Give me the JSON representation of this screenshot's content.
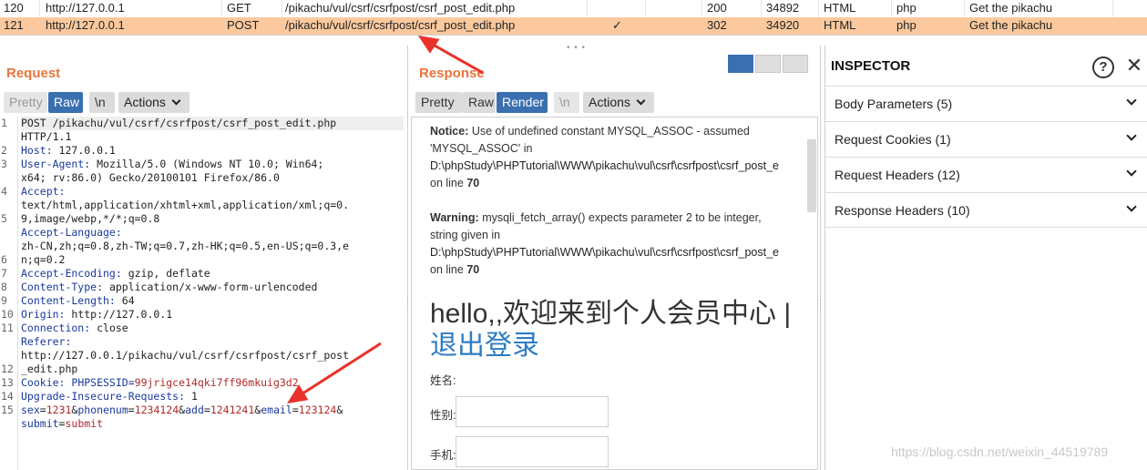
{
  "history": [
    {
      "num": "120",
      "host": "http://127.0.0.1",
      "method": "GET",
      "url": "/pikachu/vul/csrf/csrfpost/csrf_post_edit.php",
      "edited": "",
      "status": "200",
      "length": "34892",
      "mime": "HTML",
      "ext": "php",
      "title": "Get the pikachu"
    },
    {
      "num": "121",
      "host": "http://127.0.0.1",
      "method": "POST",
      "url": "/pikachu/vul/csrf/csrfpost/csrf_post_edit.php",
      "edited": "✓",
      "status": "302",
      "length": "34920",
      "mime": "HTML",
      "ext": "php",
      "title": "Get the pikachu"
    }
  ],
  "grip": "• • •",
  "request": {
    "title": "Request",
    "buttons": {
      "pretty": "Pretty",
      "raw": "Raw",
      "newline": "\\n",
      "actions": "Actions"
    },
    "line_numbers": [
      "1",
      "",
      "2",
      "3",
      "",
      "4",
      "",
      "5",
      "",
      "",
      "6",
      "7",
      "8",
      "9",
      "10",
      "11",
      "",
      "",
      "12",
      "13",
      "14",
      "15",
      ""
    ],
    "lines": [
      {
        "k": "POST /pikachu/vul/csrf/csrfpost/csrf_post_edit.php",
        "v": ""
      },
      {
        "k": "HTTP/1.1",
        "v": ""
      },
      {
        "k": "Host:",
        "v": " 127.0.0.1"
      },
      {
        "k": "User-Agent:",
        "v": " Mozilla/5.0 (Windows NT 10.0; Win64;"
      },
      {
        "k": "",
        "v": "x64; rv:86.0) Gecko/20100101 Firefox/86.0"
      },
      {
        "k": "Accept:",
        "v": ""
      },
      {
        "k": "",
        "v": "text/html,application/xhtml+xml,application/xml;q=0."
      },
      {
        "k": "",
        "v": "9,image/webp,*/*;q=0.8"
      },
      {
        "k": "Accept-Language:",
        "v": ""
      },
      {
        "k": "",
        "v": "zh-CN,zh;q=0.8,zh-TW;q=0.7,zh-HK;q=0.5,en-US;q=0.3,e"
      },
      {
        "k": "",
        "v": "n;q=0.2"
      },
      {
        "k": "Accept-Encoding:",
        "v": " gzip, deflate"
      },
      {
        "k": "Content-Type:",
        "v": " application/x-www-form-urlencoded"
      },
      {
        "k": "Content-Length:",
        "v": " 64"
      },
      {
        "k": "Origin:",
        "v": " http://127.0.0.1"
      },
      {
        "k": "Connection:",
        "v": " close"
      },
      {
        "k": "Referer:",
        "v": ""
      },
      {
        "k": "",
        "v": "http://127.0.0.1/pikachu/vul/csrf/csrfpost/csrf_post"
      },
      {
        "k": "",
        "v": "_edit.php"
      },
      {
        "k": "Cookie:",
        "v": " PHPSESSID=99jrigce14qki7ff96mkuig3d2"
      },
      {
        "k": "Upgrade-Insecure-Requests:",
        "v": " 1"
      },
      {
        "k": "",
        "v": ""
      },
      {
        "k": "",
        "v": ""
      }
    ],
    "body_params": [
      {
        "name": "sex",
        "value": "1231"
      },
      {
        "name": "phonenum",
        "value": "1234124"
      },
      {
        "name": "add",
        "value": "1241241"
      },
      {
        "name": "email",
        "value": "123124"
      },
      {
        "name": "submit",
        "value": "submit"
      }
    ]
  },
  "response": {
    "title": "Response",
    "buttons": {
      "pretty": "Pretty",
      "raw": "Raw",
      "render": "Render",
      "newline": "\\n",
      "actions": "Actions"
    },
    "notice_label": "Notice:",
    "notice_text": "Use of undefined constant MYSQL_ASSOC - assumed",
    "notice_text2": "'MYSQL_ASSOC' in",
    "path": "D:\\phpStudy\\PHPTutorial\\WWW\\pikachu\\vul\\csrf\\csrfpost\\csrf_post_e",
    "on_line": "on line",
    "line_no": "70",
    "warning_label": "Warning:",
    "warning_text": "mysqli_fetch_array() expects parameter 2 to be integer,",
    "warning_text2": "string given in",
    "hello": "hello,,欢迎来到个人会员中心 | ",
    "logout": "退出登录",
    "field_name": "姓名:",
    "field_sex": "性别:",
    "field_phone": "手机:"
  },
  "inspector": {
    "title": "INSPECTOR",
    "help": "?",
    "close": "✕",
    "sections": [
      {
        "label": "Body Parameters (5)"
      },
      {
        "label": "Request Cookies (1)"
      },
      {
        "label": "Request Headers (12)"
      },
      {
        "label": "Response Headers (10)"
      }
    ]
  },
  "watermark": "https://blog.csdn.net/weixin_44519789",
  "colors": {
    "accent": "#e8743b",
    "selected_row": "#fcc99e",
    "button_selected": "#3a6fb0",
    "arrow": "#e8322a"
  }
}
